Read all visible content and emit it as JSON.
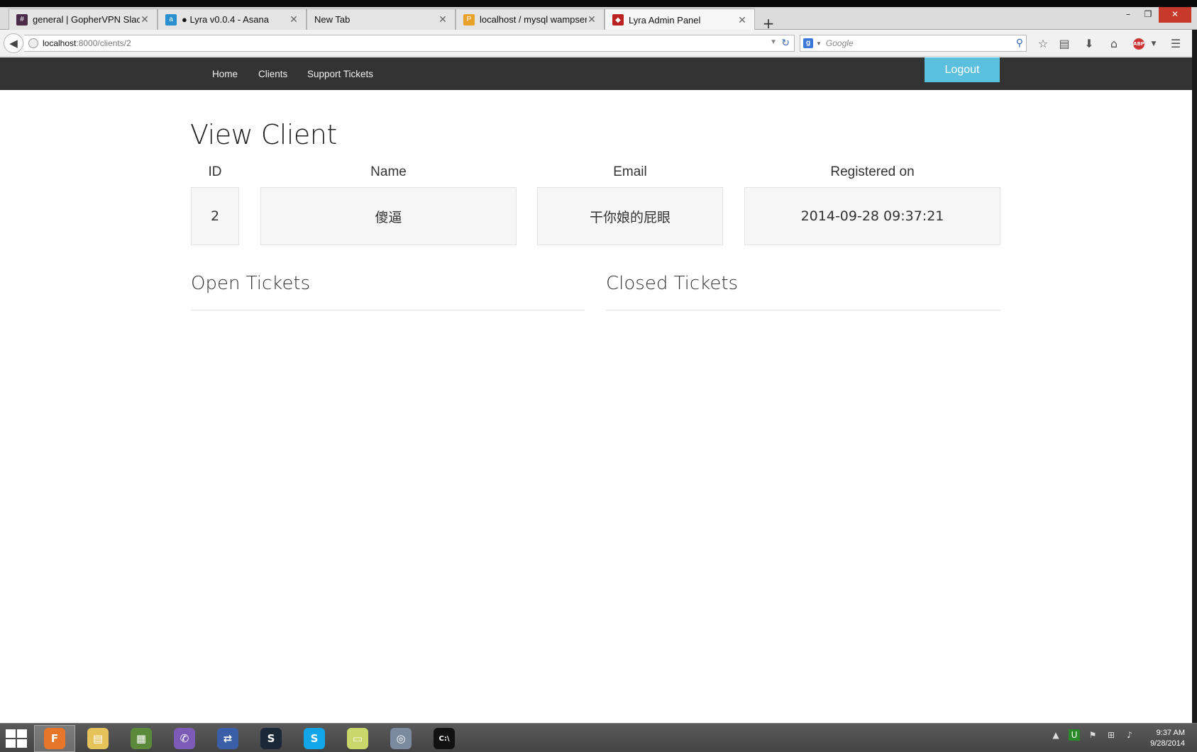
{
  "browser": {
    "tabs": [
      {
        "label": "general | GopherVPN Slack",
        "favicon_color": "#4a2c48",
        "favicon_glyph": "#"
      },
      {
        "label": "● Lyra v0.0.4 - Asana",
        "favicon_color": "#2a8fd0",
        "favicon_glyph": "a"
      },
      {
        "label": "New Tab",
        "favicon_color": "",
        "favicon_glyph": ""
      },
      {
        "label": "localhost / mysql wampser...",
        "favicon_color": "#e8a22a",
        "favicon_glyph": "P"
      },
      {
        "label": "Lyra Admin Panel",
        "favicon_color": "#b22",
        "favicon_glyph": "◆"
      }
    ],
    "new_tab_glyph": "+",
    "window_controls": {
      "minimize": "–",
      "restore": "❐",
      "close": "✕"
    },
    "url": {
      "host": "localhost",
      "path": ":8000/clients/2"
    },
    "search": {
      "placeholder": "Google",
      "engine_glyph": "g"
    }
  },
  "site": {
    "nav": {
      "home": "Home",
      "clients": "Clients",
      "tickets": "Support Tickets"
    },
    "logout": "Logout",
    "accent": "#5bc0de",
    "navbar_color": "#333333"
  },
  "client": {
    "title": "View Client",
    "headers": {
      "id": "ID",
      "name": "Name",
      "email": "Email",
      "registered": "Registered on"
    },
    "values": {
      "id": "2",
      "name": "傻逼",
      "email": "干你娘的屁眼",
      "registered": "2014-09-28 09:37:21"
    }
  },
  "sections": {
    "open": "Open Tickets",
    "closed": "Closed Tickets"
  },
  "taskbar": {
    "apps": [
      {
        "name": "firefox",
        "glyph": "F",
        "color": "#e8762a",
        "active": true
      },
      {
        "name": "file-explorer",
        "glyph": "▤",
        "color": "#e6c25a",
        "active": false
      },
      {
        "name": "minecraft",
        "glyph": "▦",
        "color": "#5a8a3a",
        "active": false
      },
      {
        "name": "viber",
        "glyph": "✆",
        "color": "#7b5bb5",
        "active": false
      },
      {
        "name": "network-tool",
        "glyph": "⇄",
        "color": "#3a5fa8",
        "active": false
      },
      {
        "name": "steam",
        "glyph": "S",
        "color": "#1b2838",
        "active": false
      },
      {
        "name": "skype",
        "glyph": "S",
        "color": "#12a5e8",
        "active": false
      },
      {
        "name": "sticky-notes",
        "glyph": "▭",
        "color": "#c8d86a",
        "active": false
      },
      {
        "name": "teamspeak",
        "glyph": "◎",
        "color": "#7c8aa0",
        "active": false
      },
      {
        "name": "command-prompt",
        "glyph": "C:\\",
        "color": "#111111",
        "active": false
      }
    ],
    "clock": {
      "time": "9:37 AM",
      "date": "9/28/2014"
    }
  }
}
